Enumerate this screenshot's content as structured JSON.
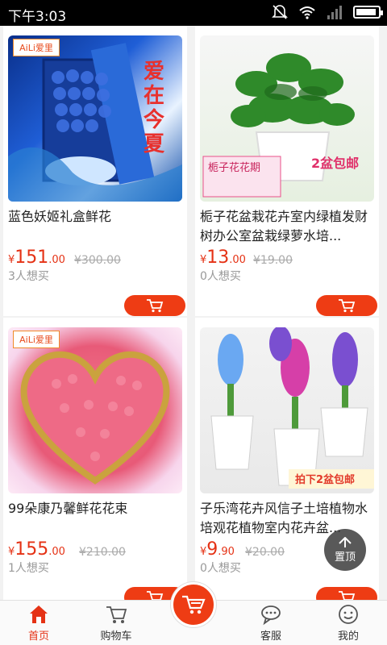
{
  "status_bar": {
    "time": "下午3:03"
  },
  "products": [
    {
      "title": "蓝色妖姬礼盒鲜花",
      "price_symbol": "¥",
      "price_int": "151",
      "price_dec": ".00",
      "original": "¥300.00",
      "wants": "3人想买",
      "badge": "AiLi爱里",
      "promo_text": "爱在今夏"
    },
    {
      "title": "栀子花盆栽花卉室内绿植发财树办公室盆栽绿萝水培...",
      "price_symbol": "¥",
      "price_int": "13",
      "price_dec": ".00",
      "original": "¥19.00",
      "wants": "0人想买",
      "promo_text": "栀子花花期",
      "promo_text2": "2盆包邮"
    },
    {
      "title": "99朵康乃馨鲜花花束",
      "price_symbol": "¥",
      "price_int": "155",
      "price_dec": ".00",
      "original": "¥210.00",
      "wants": "1人想买",
      "badge": "AiLi爱里"
    },
    {
      "title": "子乐湾花卉风信子土培植物水培观花植物室内花卉盆...",
      "price_symbol": "¥",
      "price_int": "9",
      "price_dec": ".90",
      "original": "¥20.00",
      "wants": "0人想买",
      "promo_text": "拍下2盆包邮"
    }
  ],
  "back_to_top": "置顶",
  "tabs": [
    {
      "label": "首页",
      "icon": "home-icon"
    },
    {
      "label": "购物车",
      "icon": "cart-icon"
    },
    {
      "label": "客服",
      "icon": "chat-icon"
    },
    {
      "label": "我的",
      "icon": "profile-icon"
    }
  ],
  "colors": {
    "accent": "#ee3c14",
    "price": "#e53215"
  }
}
